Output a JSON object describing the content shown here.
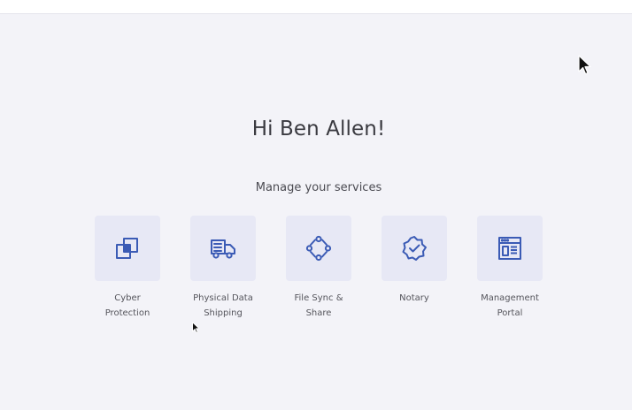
{
  "greeting": "Hi Ben Allen!",
  "subtitle": "Manage your services",
  "services": [
    {
      "label": "Cyber\nProtection",
      "icon": "cyber-protection-icon"
    },
    {
      "label": "Physical Data\nShipping",
      "icon": "truck-icon"
    },
    {
      "label": "File Sync &\nShare",
      "icon": "file-sync-icon"
    },
    {
      "label": "Notary",
      "icon": "notary-badge-icon"
    },
    {
      "label": "Management\nPortal",
      "icon": "management-portal-icon"
    }
  ],
  "colors": {
    "background": "#f3f3f8",
    "tile": "#e7e8f5",
    "icon": "#3b5bb5",
    "text": "#3a3a40"
  }
}
